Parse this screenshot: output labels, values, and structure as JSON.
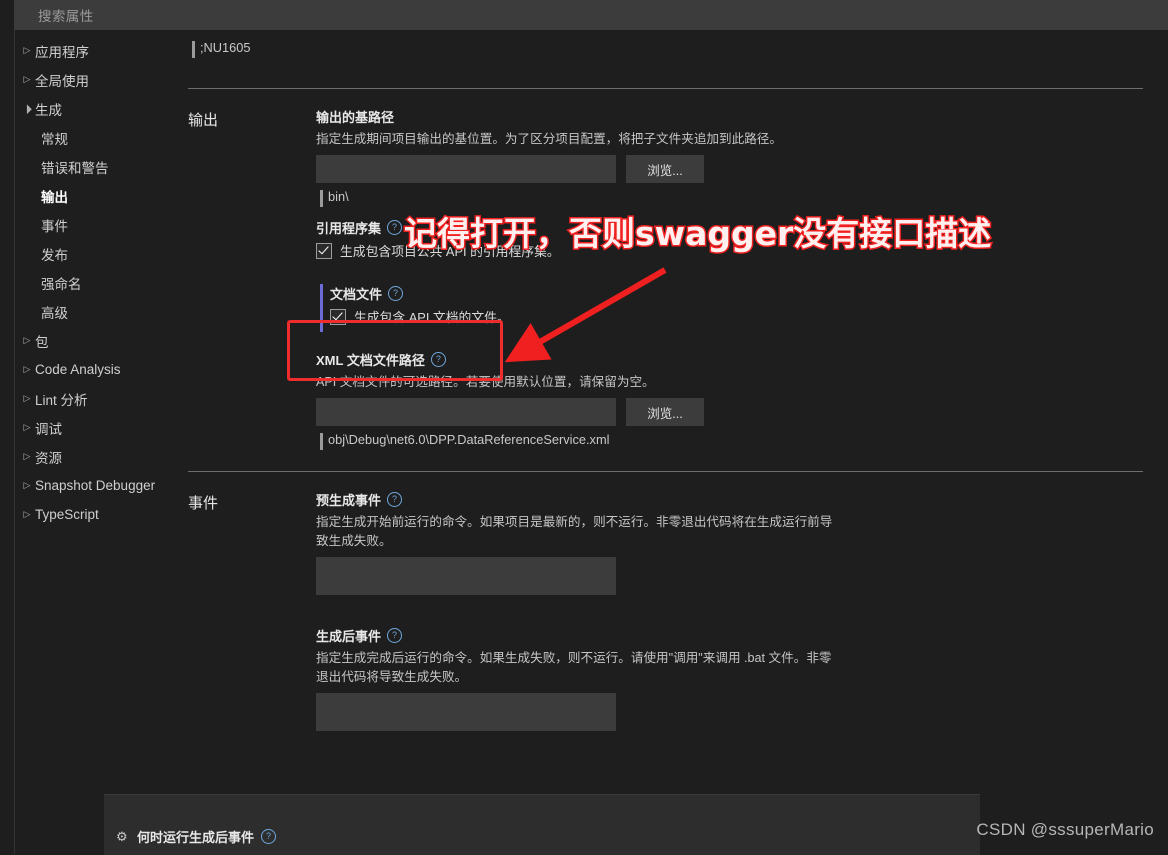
{
  "search": {
    "placeholder": "搜索属性"
  },
  "sidebar": {
    "items": [
      {
        "label": "应用程序",
        "state": "collapsed",
        "level": 0
      },
      {
        "label": "全局使用",
        "state": "collapsed",
        "level": 0
      },
      {
        "label": "生成",
        "state": "expanded",
        "level": 0
      },
      {
        "label": "常规",
        "state": "leaf",
        "level": 1
      },
      {
        "label": "错误和警告",
        "state": "leaf",
        "level": 1
      },
      {
        "label": "输出",
        "state": "leaf-active",
        "level": 1
      },
      {
        "label": "事件",
        "state": "leaf",
        "level": 1
      },
      {
        "label": "发布",
        "state": "leaf",
        "level": 1
      },
      {
        "label": "强命名",
        "state": "leaf",
        "level": 1
      },
      {
        "label": "高级",
        "state": "leaf",
        "level": 1
      },
      {
        "label": "包",
        "state": "collapsed",
        "level": 0
      },
      {
        "label": "Code Analysis",
        "state": "collapsed",
        "level": 0
      },
      {
        "label": "Lint 分析",
        "state": "collapsed",
        "level": 0
      },
      {
        "label": "调试",
        "state": "collapsed",
        "level": 0
      },
      {
        "label": "资源",
        "state": "collapsed",
        "level": 0
      },
      {
        "label": "Snapshot Debugger",
        "state": "collapsed",
        "level": 0
      },
      {
        "label": "TypeScript",
        "state": "collapsed",
        "level": 0
      }
    ]
  },
  "top_partial": {
    "value": ";NU1605"
  },
  "output_section": {
    "title": "输出",
    "base_path": {
      "label": "输出的基路径",
      "description": "指定生成期间项目输出的基位置。为了区分项目配置，将把子文件夹追加到此路径。",
      "input_value": "",
      "browse_label": "浏览...",
      "evaluated_value": "bin\\"
    },
    "ref_assembly": {
      "label": "引用程序集",
      "checkbox_label": "生成包含项目公共 API 的引用程序集。",
      "checked": true
    },
    "doc_file": {
      "label": "文档文件",
      "checkbox_label": "生成包含 API 文档的文件。",
      "checked": true
    },
    "xml_doc_path": {
      "label": "XML 文档文件路径",
      "description": "API 文档文件的可选路径。若要使用默认位置，请保留为空。",
      "input_value": "",
      "browse_label": "浏览...",
      "evaluated_value": "obj\\Debug\\net6.0\\DPP.DataReferenceService.xml"
    }
  },
  "events_section": {
    "title": "事件",
    "pre_build": {
      "label": "预生成事件",
      "description": "指定生成开始前运行的命令。如果项目是最新的，则不运行。非零退出代码将在生成运行前导致生成失败。",
      "value": ""
    },
    "post_build": {
      "label": "生成后事件",
      "description": "指定生成完成后运行的命令。如果生成失败，则不运行。请使用\"调用\"来调用 .bat 文件。非零退出代码将导致生成失败。",
      "value": ""
    },
    "run_post_build_when": {
      "label": "何时运行生成后事件",
      "icon": "gear-icon"
    }
  },
  "annotation": {
    "text": "记得打开，否则swagger没有接口描述",
    "color": "#f02020"
  },
  "watermark": {
    "text": "CSDN @sssuperMario"
  },
  "icons": {
    "help": "?",
    "gear": "⚙",
    "arrow_collapsed": "▷"
  }
}
